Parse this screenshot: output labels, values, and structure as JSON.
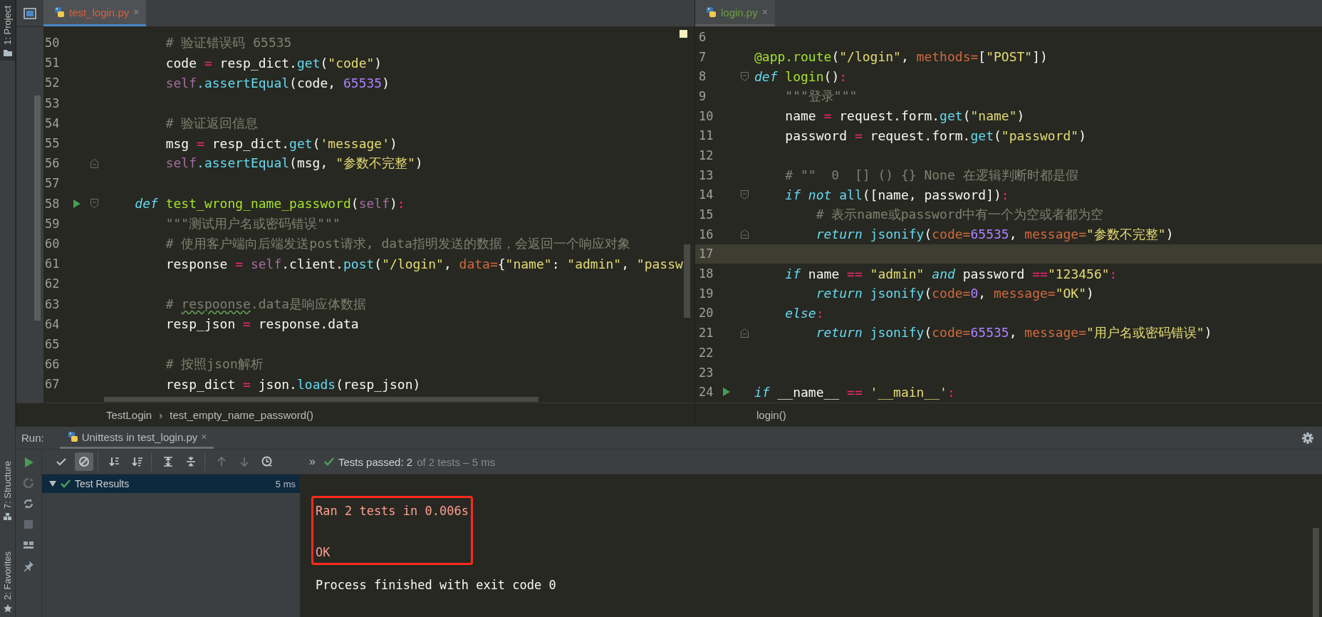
{
  "tool_strip": {
    "top": [
      {
        "label": "1: Project"
      }
    ],
    "bottom": [
      {
        "label": "7: Structure"
      },
      {
        "label": "2: Favorites"
      }
    ]
  },
  "left_editor": {
    "tab": {
      "label": "test_login.py",
      "close": "×",
      "color": "#d8603f",
      "selected": true
    },
    "lines": [
      {
        "number": "50",
        "run": false,
        "fold_start": false,
        "fold_end": false,
        "tokens": [
          {
            "kind": "comment",
            "text": "        # 验证错误码 65535"
          }
        ]
      },
      {
        "number": "51",
        "run": false,
        "fold_start": false,
        "fold_end": false,
        "tokens": [
          {
            "kind": "plain",
            "text": "        code "
          },
          {
            "kind": "operator",
            "text": "="
          },
          {
            "kind": "plain",
            "text": " resp_dict."
          },
          {
            "kind": "call",
            "text": "get"
          },
          {
            "kind": "plain",
            "text": "("
          },
          {
            "kind": "string",
            "text": "\"code\""
          },
          {
            "kind": "plain",
            "text": ")"
          }
        ]
      },
      {
        "number": "52",
        "run": false,
        "fold_start": false,
        "fold_end": false,
        "tokens": [
          {
            "kind": "self",
            "text": "        self"
          },
          {
            "kind": "call",
            "text": ".assertEqual"
          },
          {
            "kind": "plain",
            "text": "(code, "
          },
          {
            "kind": "number",
            "text": "65535"
          },
          {
            "kind": "plain",
            "text": ")"
          }
        ]
      },
      {
        "number": "53",
        "run": false,
        "fold_start": false,
        "fold_end": false
      },
      {
        "number": "54",
        "run": false,
        "fold_start": false,
        "fold_end": false,
        "tokens": [
          {
            "kind": "comment",
            "text": "        # 验证返回信息"
          }
        ]
      },
      {
        "number": "55",
        "run": false,
        "fold_start": false,
        "fold_end": false,
        "tokens": [
          {
            "kind": "plain",
            "text": "        msg "
          },
          {
            "kind": "operator",
            "text": "="
          },
          {
            "kind": "plain",
            "text": " resp_dict."
          },
          {
            "kind": "call",
            "text": "get"
          },
          {
            "kind": "plain",
            "text": "("
          },
          {
            "kind": "string",
            "text": "'message'"
          },
          {
            "kind": "plain",
            "text": ")"
          }
        ]
      },
      {
        "number": "56",
        "run": false,
        "fold_start": false,
        "fold_end": true,
        "tokens": [
          {
            "kind": "self",
            "text": "        self"
          },
          {
            "kind": "call",
            "text": ".assertEqual"
          },
          {
            "kind": "plain",
            "text": "(msg, "
          },
          {
            "kind": "string",
            "text": "\"参数不完整\""
          },
          {
            "kind": "plain",
            "text": ")"
          }
        ]
      },
      {
        "number": "57",
        "run": false,
        "fold_start": false,
        "fold_end": false
      },
      {
        "number": "58",
        "run": true,
        "fold_start": true,
        "fold_end": false,
        "tokens": [
          {
            "kind": "keyword",
            "text": "    def"
          },
          {
            "kind": "function",
            "text": " test_wrong_name_password"
          },
          {
            "kind": "plain",
            "text": "("
          },
          {
            "kind": "self",
            "text": "self"
          },
          {
            "kind": "plain",
            "text": ")"
          },
          {
            "kind": "operator",
            "text": ":"
          }
        ]
      },
      {
        "number": "59",
        "run": false,
        "fold_start": false,
        "fold_end": false,
        "tokens": [
          {
            "kind": "docstring",
            "text": "        \"\"\"测试用户名或密码错误\"\"\""
          }
        ]
      },
      {
        "number": "60",
        "run": false,
        "fold_start": false,
        "fold_end": false,
        "tokens": [
          {
            "kind": "comment",
            "text": "        # 使用客户端向后端发送post请求, data指明发送的数据，会返回一个响应对象"
          }
        ]
      },
      {
        "number": "61",
        "run": false,
        "fold_start": false,
        "fold_end": false,
        "tokens": [
          {
            "kind": "plain",
            "text": "        response "
          },
          {
            "kind": "operator",
            "text": "="
          },
          {
            "kind": "self",
            "text": " self"
          },
          {
            "kind": "plain",
            "text": ".client."
          },
          {
            "kind": "call",
            "text": "post"
          },
          {
            "kind": "plain",
            "text": "("
          },
          {
            "kind": "string",
            "text": "\"/login\""
          },
          {
            "kind": "plain",
            "text": ", "
          },
          {
            "kind": "param",
            "text": "data="
          },
          {
            "kind": "plain",
            "text": "{"
          },
          {
            "kind": "string",
            "text": "\"name\""
          },
          {
            "kind": "plain",
            "text": ": "
          },
          {
            "kind": "string",
            "text": "\"admin\""
          },
          {
            "kind": "plain",
            "text": ", "
          },
          {
            "kind": "string",
            "text": "\"passw"
          }
        ]
      },
      {
        "number": "62",
        "run": false,
        "fold_start": false,
        "fold_end": false
      },
      {
        "number": "63",
        "run": false,
        "fold_start": false,
        "fold_end": false,
        "tokens": [
          {
            "kind": "comment",
            "text": "        # "
          },
          {
            "kind": "typo",
            "text": "respoonse"
          },
          {
            "kind": "comment",
            "text": ".data是响应体数据"
          }
        ]
      },
      {
        "number": "64",
        "run": false,
        "fold_start": false,
        "fold_end": false,
        "tokens": [
          {
            "kind": "plain",
            "text": "        resp_json "
          },
          {
            "kind": "operator",
            "text": "="
          },
          {
            "kind": "plain",
            "text": " response.data"
          }
        ]
      },
      {
        "number": "65",
        "run": false,
        "fold_start": false,
        "fold_end": false
      },
      {
        "number": "66",
        "run": false,
        "fold_start": false,
        "fold_end": false,
        "tokens": [
          {
            "kind": "comment",
            "text": "        # 按照json解析"
          }
        ]
      },
      {
        "number": "67",
        "run": false,
        "fold_start": false,
        "fold_end": false,
        "tokens": [
          {
            "kind": "plain",
            "text": "        resp_dict "
          },
          {
            "kind": "operator",
            "text": "="
          },
          {
            "kind": "plain",
            "text": " json."
          },
          {
            "kind": "call",
            "text": "loads"
          },
          {
            "kind": "plain",
            "text": "(resp_json)"
          }
        ]
      }
    ],
    "breadcrumbs": [
      "TestLogin",
      "test_empty_name_password()"
    ],
    "breadcrumb_separator": "›"
  },
  "right_editor": {
    "tab": {
      "label": "login.py",
      "close": "×",
      "color": "#6c9d43",
      "selected": false
    },
    "lines": [
      {
        "number": "6",
        "current": false,
        "run": false,
        "fold_start": false,
        "fold_end": false
      },
      {
        "number": "7",
        "current": false,
        "run": false,
        "fold_start": false,
        "fold_end": false,
        "tokens": [
          {
            "kind": "decorator",
            "text": "@app.route"
          },
          {
            "kind": "plain",
            "text": "("
          },
          {
            "kind": "string",
            "text": "\"/login\""
          },
          {
            "kind": "plain",
            "text": ", "
          },
          {
            "kind": "param",
            "text": "methods="
          },
          {
            "kind": "plain",
            "text": "["
          },
          {
            "kind": "string",
            "text": "\"POST\""
          },
          {
            "kind": "plain",
            "text": "])"
          }
        ]
      },
      {
        "number": "8",
        "current": false,
        "run": false,
        "fold_start": true,
        "fold_end": false,
        "tokens": [
          {
            "kind": "keyword",
            "text": "def"
          },
          {
            "kind": "function",
            "text": " login"
          },
          {
            "kind": "plain",
            "text": "()"
          },
          {
            "kind": "operator",
            "text": ":"
          }
        ]
      },
      {
        "number": "9",
        "current": false,
        "run": false,
        "fold_start": false,
        "fold_end": false,
        "tokens": [
          {
            "kind": "docstring",
            "text": "    \"\"\"登录\"\"\""
          }
        ]
      },
      {
        "number": "10",
        "current": false,
        "run": false,
        "fold_start": false,
        "fold_end": false,
        "tokens": [
          {
            "kind": "plain",
            "text": "    name "
          },
          {
            "kind": "operator",
            "text": "="
          },
          {
            "kind": "plain",
            "text": " request.form."
          },
          {
            "kind": "call",
            "text": "get"
          },
          {
            "kind": "plain",
            "text": "("
          },
          {
            "kind": "string",
            "text": "\"name\""
          },
          {
            "kind": "plain",
            "text": ")"
          }
        ]
      },
      {
        "number": "11",
        "current": false,
        "run": false,
        "fold_start": false,
        "fold_end": false,
        "tokens": [
          {
            "kind": "plain",
            "text": "    password "
          },
          {
            "kind": "operator",
            "text": "="
          },
          {
            "kind": "plain",
            "text": " request.form."
          },
          {
            "kind": "call",
            "text": "get"
          },
          {
            "kind": "plain",
            "text": "("
          },
          {
            "kind": "string",
            "text": "\"password\""
          },
          {
            "kind": "plain",
            "text": ")"
          }
        ]
      },
      {
        "number": "12",
        "current": false,
        "run": false,
        "fold_start": false,
        "fold_end": false
      },
      {
        "number": "13",
        "current": false,
        "run": false,
        "fold_start": false,
        "fold_end": false,
        "tokens": [
          {
            "kind": "comment",
            "text": "    # \"\"  0  [] () {} None 在逻辑判断时都是假"
          }
        ]
      },
      {
        "number": "14",
        "current": false,
        "run": false,
        "fold_start": true,
        "fold_end": false,
        "tokens": [
          {
            "kind": "keyword",
            "text": "    if"
          },
          {
            "kind": "keyword",
            "text": " not"
          },
          {
            "kind": "call",
            "text": " all"
          },
          {
            "kind": "plain",
            "text": "([name, password])"
          },
          {
            "kind": "operator",
            "text": ":"
          }
        ]
      },
      {
        "number": "15",
        "current": false,
        "run": false,
        "fold_start": false,
        "fold_end": false,
        "tokens": [
          {
            "kind": "comment",
            "text": "        # 表示name或password中有一个为空或者都为空"
          }
        ]
      },
      {
        "number": "16",
        "current": false,
        "run": false,
        "fold_start": false,
        "fold_end": true,
        "tokens": [
          {
            "kind": "keyword",
            "text": "        return"
          },
          {
            "kind": "call",
            "text": " jsonify"
          },
          {
            "kind": "plain",
            "text": "("
          },
          {
            "kind": "param",
            "text": "code="
          },
          {
            "kind": "number",
            "text": "65535"
          },
          {
            "kind": "plain",
            "text": ", "
          },
          {
            "kind": "param",
            "text": "message="
          },
          {
            "kind": "string",
            "text": "\"参数不完整\""
          },
          {
            "kind": "plain",
            "text": ")"
          }
        ]
      },
      {
        "number": "17",
        "current": true,
        "run": false,
        "fold_start": false,
        "fold_end": false
      },
      {
        "number": "18",
        "current": false,
        "run": false,
        "fold_start": false,
        "fold_end": false,
        "tokens": [
          {
            "kind": "keyword",
            "text": "    if"
          },
          {
            "kind": "plain",
            "text": " name "
          },
          {
            "kind": "operator",
            "text": "=="
          },
          {
            "kind": "string",
            "text": " \"admin\""
          },
          {
            "kind": "keyword",
            "text": " and"
          },
          {
            "kind": "plain",
            "text": " password "
          },
          {
            "kind": "operator",
            "text": "=="
          },
          {
            "kind": "string",
            "text": "\"123456\""
          },
          {
            "kind": "operator",
            "text": ":"
          }
        ]
      },
      {
        "number": "19",
        "current": false,
        "run": false,
        "fold_start": false,
        "fold_end": false,
        "tokens": [
          {
            "kind": "keyword",
            "text": "        return"
          },
          {
            "kind": "call",
            "text": " jsonify"
          },
          {
            "kind": "plain",
            "text": "("
          },
          {
            "kind": "param",
            "text": "code="
          },
          {
            "kind": "number",
            "text": "0"
          },
          {
            "kind": "plain",
            "text": ", "
          },
          {
            "kind": "param",
            "text": "message="
          },
          {
            "kind": "string",
            "text": "\"OK\""
          },
          {
            "kind": "plain",
            "text": ")"
          }
        ]
      },
      {
        "number": "20",
        "current": false,
        "run": false,
        "fold_start": false,
        "fold_end": false,
        "tokens": [
          {
            "kind": "keyword",
            "text": "    else"
          },
          {
            "kind": "operator",
            "text": ":"
          }
        ]
      },
      {
        "number": "21",
        "current": false,
        "run": false,
        "fold_start": false,
        "fold_end": true,
        "tokens": [
          {
            "kind": "keyword",
            "text": "        return"
          },
          {
            "kind": "call",
            "text": " jsonify"
          },
          {
            "kind": "plain",
            "text": "("
          },
          {
            "kind": "param",
            "text": "code="
          },
          {
            "kind": "number",
            "text": "65535"
          },
          {
            "kind": "plain",
            "text": ", "
          },
          {
            "kind": "param",
            "text": "message="
          },
          {
            "kind": "string",
            "text": "\"用户名或密码错误\""
          },
          {
            "kind": "plain",
            "text": ")"
          }
        ]
      },
      {
        "number": "22",
        "current": false,
        "run": false,
        "fold_start": false,
        "fold_end": false
      },
      {
        "number": "23",
        "current": false,
        "run": false,
        "fold_start": false,
        "fold_end": false
      },
      {
        "number": "24",
        "current": false,
        "run": true,
        "fold_start": false,
        "fold_end": false,
        "tokens": [
          {
            "kind": "keyword",
            "text": "if"
          },
          {
            "kind": "plain",
            "text": " __name__ "
          },
          {
            "kind": "operator",
            "text": "=="
          },
          {
            "kind": "string",
            "text": " '__main__'"
          },
          {
            "kind": "operator",
            "text": ":"
          }
        ]
      }
    ],
    "breadcrumbs": [
      "login()"
    ]
  },
  "run_panel": {
    "label": "Run:",
    "tab": {
      "label": "Unittests in test_login.py",
      "close": "×"
    },
    "side_actions": [
      {
        "kind": "run",
        "disabled": false
      },
      {
        "kind": "rerun-failed",
        "disabled": true
      },
      {
        "kind": "auto-test",
        "disabled": false
      },
      {
        "kind": "stop",
        "disabled": true
      },
      {
        "kind": "layout",
        "disabled": false
      },
      {
        "kind": "pin",
        "disabled": false
      }
    ],
    "toolbar": [
      [
        {
          "kind": "check",
          "on": false,
          "disabled": false
        },
        {
          "kind": "ignored",
          "on": true,
          "disabled": false
        }
      ],
      [
        {
          "kind": "sort-alpha",
          "on": false,
          "disabled": false
        },
        {
          "kind": "sort-duration",
          "on": false,
          "disabled": false
        }
      ],
      [
        {
          "kind": "expand-all",
          "on": false,
          "disabled": false
        },
        {
          "kind": "collapse-all",
          "on": false,
          "disabled": false
        }
      ],
      [
        {
          "kind": "up",
          "on": false,
          "disabled": true
        },
        {
          "kind": "down",
          "on": false,
          "disabled": true
        },
        {
          "kind": "history",
          "on": false,
          "disabled": false
        }
      ]
    ],
    "more": "»",
    "status": {
      "summary": "Tests passed: 2",
      "detail": "of 2 tests – 5 ms"
    },
    "tree": [
      {
        "label": "Test Results",
        "time": "5 ms",
        "selected": true,
        "expanded": true
      }
    ],
    "console": [
      {
        "kind": "stderr",
        "boxed": true,
        "lines": [
          "Ran 2 tests in 0.006s",
          "OK"
        ]
      },
      {
        "kind": "stdout",
        "boxed": false,
        "lines": [
          "Process finished with exit code 0"
        ]
      }
    ]
  }
}
